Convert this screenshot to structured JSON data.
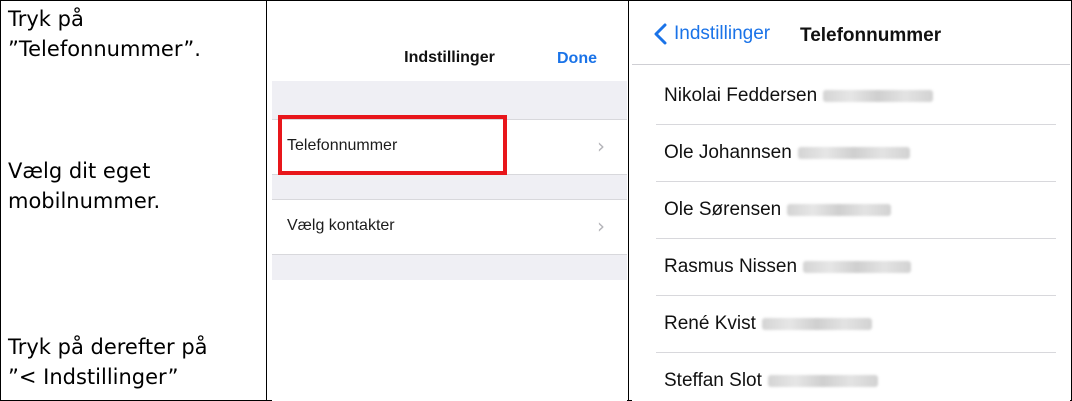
{
  "instructions": {
    "step1": [
      "Tryk på",
      "”Telefonnummer”."
    ],
    "step2": [
      "Vælg dit eget",
      "mobilnummer."
    ],
    "step3": [
      "Tryk på derefter på",
      "”< Indstillinger”"
    ]
  },
  "settings_screen": {
    "title": "Indstillinger",
    "done_label": "Done",
    "items": [
      {
        "label": "Telefonnummer",
        "highlighted": true
      },
      {
        "label": "Vælg kontakter",
        "highlighted": false
      }
    ],
    "highlight_color": "#e8161b"
  },
  "phone_screen": {
    "back_label": "Indstillinger",
    "title": "Telefonnummer",
    "contacts": [
      {
        "name": "Nikolai Feddersen",
        "number_obscured": true
      },
      {
        "name": "Ole Johannsen",
        "number_obscured": true
      },
      {
        "name": "Ole Sørensen",
        "number_obscured": true
      },
      {
        "name": "Rasmus Nissen",
        "number_obscured": true
      },
      {
        "name": "René Kvist",
        "number_obscured": true
      },
      {
        "name": "Steffan Slot",
        "number_obscured": true
      }
    ],
    "accent_color": "#1a73e8"
  }
}
